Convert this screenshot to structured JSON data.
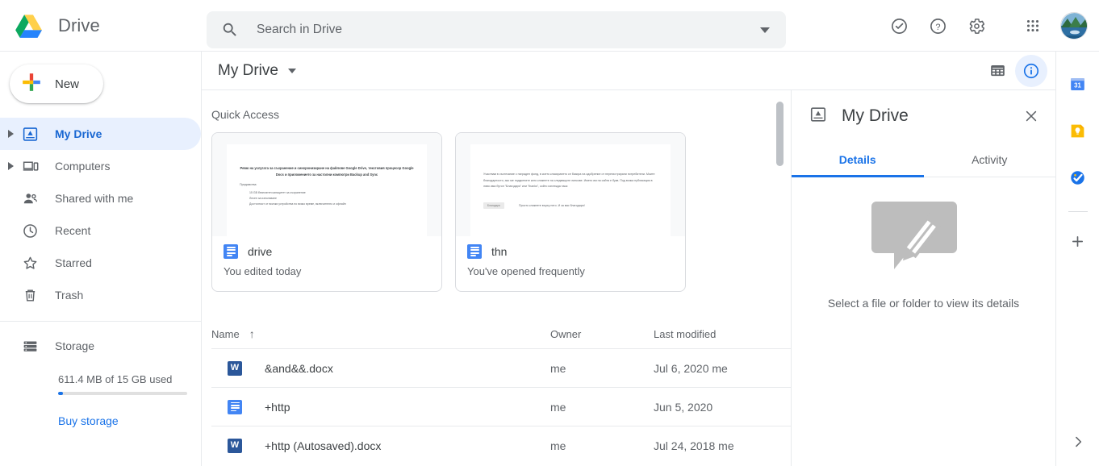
{
  "app": {
    "brand_title": "Drive",
    "logo_icon": "google-drive-logo"
  },
  "search": {
    "placeholder": "Search in Drive",
    "value": "",
    "icon": "search-icon",
    "options_icon": "chevron-down-icon"
  },
  "topbar_actions": [
    {
      "name": "support-icon",
      "label": "Support"
    },
    {
      "name": "help-icon",
      "label": "Help"
    },
    {
      "name": "settings-gear-icon",
      "label": "Settings"
    },
    {
      "name": "apps-grid-icon",
      "label": "Google apps"
    },
    {
      "name": "account-avatar",
      "label": "Google Account"
    }
  ],
  "sidebar": {
    "new_button": {
      "label": "New",
      "icon": "plus-icon"
    },
    "items": [
      {
        "label": "My Drive",
        "icon": "drive-icon",
        "active": true,
        "expandable": true
      },
      {
        "label": "Computers",
        "icon": "computer-icon",
        "active": false,
        "expandable": true
      },
      {
        "label": "Shared with me",
        "icon": "people-icon",
        "active": false,
        "expandable": false
      },
      {
        "label": "Recent",
        "icon": "clock-icon",
        "active": false,
        "expandable": false
      },
      {
        "label": "Starred",
        "icon": "star-icon",
        "active": false,
        "expandable": false
      },
      {
        "label": "Trash",
        "icon": "trash-icon",
        "active": false,
        "expandable": false
      }
    ],
    "storage": {
      "label": "Storage",
      "icon": "storage-icon",
      "usage_text": "611.4 MB of 15 GB used",
      "percent_used": 4,
      "buy_link": "Buy storage"
    }
  },
  "main_header": {
    "breadcrumb_title": "My Drive",
    "breadcrumb_caret": "chevron-down-icon",
    "grid_view_button": {
      "name": "grid-view-icon",
      "active": false
    },
    "details_button": {
      "name": "info-icon",
      "active": true
    }
  },
  "quick_access": {
    "section_title": "Quick Access",
    "cards": [
      {
        "name": "drive",
        "reason": "You edited today",
        "file_icon": "google-docs-icon",
        "thumb": {
          "heading": "Ревю на услугата за съхранение и синхронизиране на файлове Google Drive, текстовия процесор Google Docs и приложението за настолни компютри Backup and Sync",
          "subheading": "Предимства:",
          "bullets": [
            "15 GB безплатен капацитет за съхранение",
            "Лесен за използване",
            "Достъпност от всички устройства по всяко време, включително и офлайн"
          ]
        }
      },
      {
        "name": "thn",
        "reason": "You've opened frequently",
        "file_icon": "google-docs-icon",
        "thumb": {
          "paragraph": "Участвам в състезание с награден фонд, в което класирането се базира на одобрение от нерегистрирани потребители. Моите благодарности, ако ме подкрепите като кликнете на следващите линкове. Името им на сайта е букв. Под всяка публикация в ляво има бутон \"Благодаря\" или \"thanks\", който изглежда така:",
          "button_label": "Благодаря",
          "note": "Просто кликнете върху него. И за вас благодаря!"
        }
      }
    ]
  },
  "file_table": {
    "columns": {
      "name": "Name",
      "sort_indicator": "↑",
      "owner": "Owner",
      "last_modified": "Last modified"
    },
    "rows": [
      {
        "name": "&and&&.docx",
        "icon": "word-doc-icon",
        "owner": "me",
        "last_modified": "Jul 6, 2020 me"
      },
      {
        "name": "+http",
        "icon": "google-docs-icon",
        "owner": "me",
        "last_modified": "Jun 5, 2020"
      },
      {
        "name": "+http (Autosaved).docx",
        "icon": "word-doc-icon",
        "owner": "me",
        "last_modified": "Jul 24, 2018 me"
      }
    ]
  },
  "details_panel": {
    "title": "My Drive",
    "title_icon": "drive-icon",
    "close_icon": "close-icon",
    "tabs": [
      {
        "label": "Details",
        "active": true
      },
      {
        "label": "Activity",
        "active": false
      }
    ],
    "empty_state": {
      "illustration": "speech-bubble-pencil-illustration",
      "text": "Select a file or folder to view its details"
    }
  },
  "right_strip": {
    "apps": [
      {
        "name": "google-calendar-icon",
        "label": "Calendar",
        "badge": "31"
      },
      {
        "name": "google-keep-icon",
        "label": "Keep"
      },
      {
        "name": "google-tasks-icon",
        "label": "Tasks"
      }
    ],
    "add_button": {
      "name": "add-shortcut-icon",
      "label": "+"
    },
    "expand_button": {
      "name": "chevron-right-icon",
      "label": "›"
    }
  },
  "colors": {
    "accent_blue": "#1a73e8",
    "active_nav_bg": "#e8f0fe",
    "active_nav_text": "#1967d2",
    "text_primary": "#3c4043",
    "text_secondary": "#5f6368",
    "border": "#e8eaed",
    "search_bg": "#f1f3f4"
  }
}
